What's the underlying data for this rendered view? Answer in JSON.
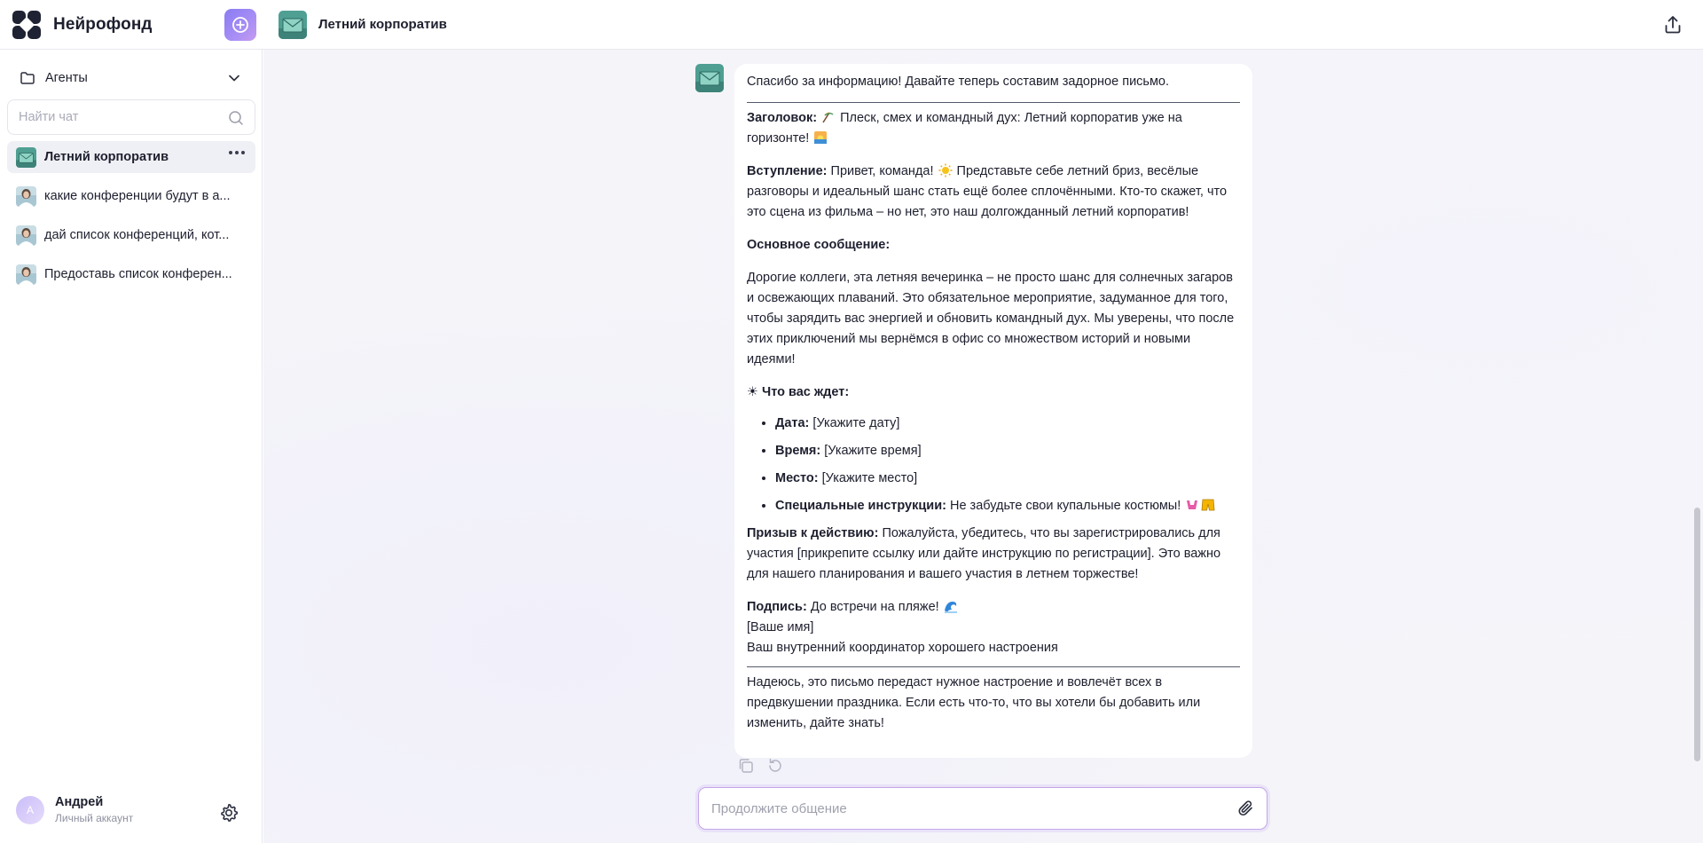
{
  "app": {
    "name": "Нейрофонд",
    "logo_icon": "neirofond-logo-icon"
  },
  "header": {
    "new_chat_icon": "plus-circle-icon",
    "chat_title": "Летний корпоратив",
    "share_icon": "share-upload-icon"
  },
  "sidebar": {
    "agents_label": "Агенты",
    "search_placeholder": "Найти чат",
    "chats": [
      {
        "label": "Летний корпоратив",
        "active": true,
        "icon": "envelope-agent-icon"
      },
      {
        "label": "какие конференции будут в а...",
        "active": false,
        "icon": "person-avatar-icon"
      },
      {
        "label": "дай список конференций, кот...",
        "active": false,
        "icon": "person-avatar-icon"
      },
      {
        "label": "Предоставь список конферен...",
        "active": false,
        "icon": "person-avatar-icon"
      }
    ],
    "user": {
      "initial": "А",
      "name": "Андрей",
      "account_type": "Личный аккаунт"
    }
  },
  "message": {
    "intro": "Спасибо за информацию! Давайте теперь составим задорное письмо.",
    "subject_label": "Заголовок:",
    "subject_text": "Плеск, смех и командный дух: Летний корпоратив уже на горизонте!",
    "greeting_label": "Вступление:",
    "greeting_a": "Привет, команда!",
    "greeting_b": "Представьте себе летний бриз, весёлые разговоры и идеальный шанс стать ещё более сплочёнными. Кто-то скажет, что это сцена из фильма – но нет, это наш долгожданный летний корпоратив!",
    "main_label": "Основное сообщение:",
    "main_text": "Дорогие коллеги, эта летняя вечеринка – не просто шанс для солнечных загаров и освежающих плаваний. Это обязательное мероприятие, задуманное для того, чтобы зарядить вас энергией и обновить командный дух. Мы уверены, что после этих приключений мы вернёмся в офис со множеством историй и новыми идеями!",
    "expect_label": "☀ Что вас ждет:",
    "details": [
      {
        "label": "Дата:",
        "value": "[Укажите дату]"
      },
      {
        "label": "Время:",
        "value": "[Укажите время]"
      },
      {
        "label": "Место:",
        "value": "[Укажите место]"
      },
      {
        "label": "Специальные инструкции:",
        "value": "Не забудьте свои купальные костюмы!"
      }
    ],
    "cta_label": "Призыв к действию:",
    "cta_text": "Пожалуйста, убедитесь, что вы зарегистрировались для участия [прикрепите ссылку или дайте инструкцию по регистрации]. Это важно для нашего планирования и вашего участия в летнем торжестве!",
    "sign_label": "Подпись:",
    "sign_text": "До встречи на пляже!",
    "sign_name": "[Ваше имя]",
    "sign_role": "Ваш внутренний координатор хорошего настроения",
    "closing": "Надеюсь, это письмо передаст нужное настроение и вовлечёт всех в предвкушении праздника. Если есть что-то, что вы хотели бы добавить или изменить, дайте знать!"
  },
  "actions": {
    "copy_icon": "copy-icon",
    "regenerate_icon": "regenerate-icon"
  },
  "composer": {
    "placeholder": "Продолжите общение",
    "attach_icon": "paperclip-icon"
  },
  "colors": {
    "accent": "#8a7cf2",
    "agent_teal": "#4fa89a",
    "background": "#f5f5f9"
  }
}
